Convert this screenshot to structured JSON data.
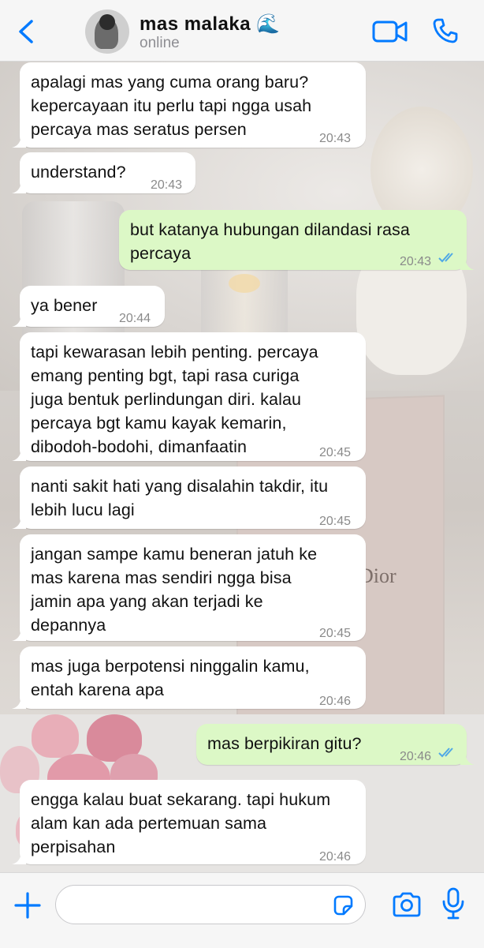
{
  "header": {
    "back_icon": "chevron-left-icon",
    "contact_name": "mas malaka 🌊",
    "status": "online",
    "video_icon": "video-camera-icon",
    "phone_icon": "phone-icon"
  },
  "wallpaper": {
    "book_text": "Dior"
  },
  "messages": [
    {
      "direction": "in",
      "text": "apalagi mas yang cuma orang baru?\nkepercayaan itu perlu tapi ngga usah\npercaya mas seratus persen",
      "time": "20:43"
    },
    {
      "direction": "in",
      "text": "understand?",
      "time": "20:43"
    },
    {
      "direction": "out",
      "text": "but katanya hubungan dilandasi rasa\npercaya",
      "time": "20:43",
      "read": true
    },
    {
      "direction": "in",
      "text": "ya bener",
      "time": "20:44"
    },
    {
      "direction": "in",
      "text": "tapi kewarasan lebih penting. percaya\nemang penting bgt, tapi rasa curiga\njuga bentuk perlindungan diri. kalau\npercaya bgt kamu kayak kemarin,\ndibodoh-bodohi, dimanfaatin",
      "time": "20:45"
    },
    {
      "direction": "in",
      "text": "nanti sakit hati yang disalahin takdir, itu\nlebih lucu lagi",
      "time": "20:45"
    },
    {
      "direction": "in",
      "text": "jangan sampe kamu beneran jatuh ke\nmas karena mas sendiri ngga bisa\njamin apa yang akan terjadi ke\ndepannya",
      "time": "20:45"
    },
    {
      "direction": "in",
      "text": "mas juga berpotensi ninggalin kamu,\nentah karena apa",
      "time": "20:46"
    },
    {
      "direction": "out",
      "text": "mas berpikiran gitu?",
      "time": "20:46",
      "read": true
    },
    {
      "direction": "in",
      "text": "engga kalau buat sekarang. tapi hukum\nalam kan ada pertemuan sama\nperpisahan",
      "time": "20:46"
    }
  ],
  "composer": {
    "plus_icon": "plus-icon",
    "input_value": "",
    "sticker_icon": "sticker-icon",
    "camera_icon": "camera-icon",
    "mic_icon": "microphone-icon"
  },
  "colors": {
    "accent": "#007aff",
    "outgoing_bubble": "#dcf8c6",
    "incoming_bubble": "#ffffff",
    "read_ticks": "#4fa8e6"
  }
}
